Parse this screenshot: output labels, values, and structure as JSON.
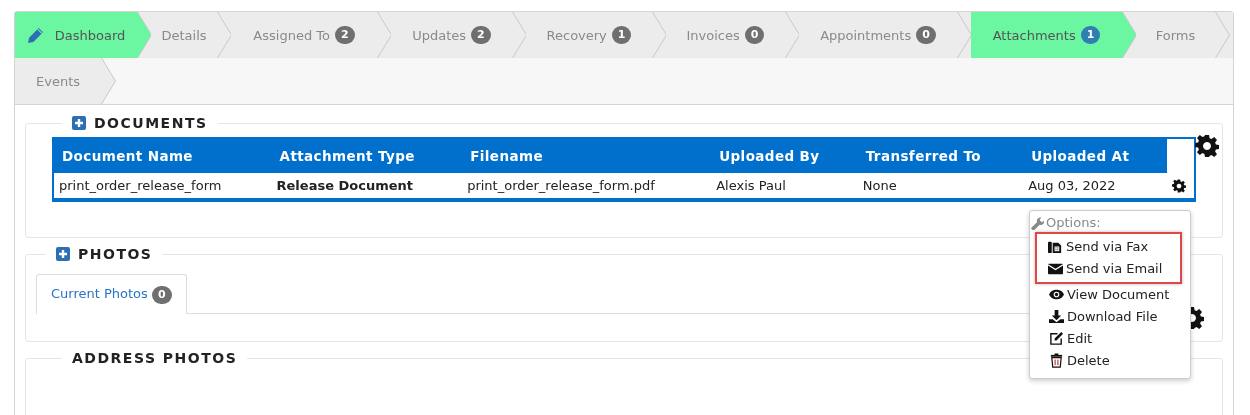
{
  "tabs": [
    {
      "label": "Dashboard",
      "kind": "home",
      "selected": true
    },
    {
      "label": "Details",
      "kind": "plain",
      "selected": false
    },
    {
      "label": "Assigned To",
      "kind": "plain",
      "selected": false,
      "count": "2"
    },
    {
      "label": "Updates",
      "kind": "plain",
      "selected": false,
      "count": "2"
    },
    {
      "label": "Recovery",
      "kind": "plain",
      "selected": false,
      "count": "1"
    },
    {
      "label": "Invoices",
      "kind": "plain",
      "selected": false,
      "count": "0"
    },
    {
      "label": "Appointments",
      "kind": "plain",
      "selected": false,
      "count": "0"
    },
    {
      "label": "Attachments",
      "kind": "plain",
      "selected": true,
      "count": "1"
    },
    {
      "label": "Forms",
      "kind": "plain",
      "selected": false
    },
    {
      "label": "Events",
      "kind": "plain",
      "selected": false
    }
  ],
  "documents": {
    "title": "DOCUMENTS",
    "columns": [
      "Document Name",
      "Attachment Type",
      "Filename",
      "Uploaded By",
      "Transferred To",
      "Uploaded At"
    ],
    "rows": [
      {
        "cells": [
          "print_order_release_form",
          "Release Document",
          "print_order_release_form.pdf",
          "Alexis Paul",
          "None",
          "Aug 03, 2022"
        ]
      }
    ]
  },
  "options_menu": {
    "header": "Options:",
    "items": [
      {
        "label": "Send via Fax",
        "highlighted": true
      },
      {
        "label": "Send via Email",
        "highlighted": true
      },
      {
        "label": "View Document",
        "highlighted": false
      },
      {
        "label": "Download File",
        "highlighted": false
      },
      {
        "label": "Edit",
        "highlighted": false
      },
      {
        "label": "Delete",
        "highlighted": false
      }
    ]
  },
  "photos": {
    "title": "PHOTOS",
    "tabs": [
      {
        "label": "Current Photos",
        "count": "0",
        "selected": true
      }
    ]
  },
  "address_photos": {
    "title": "ADDRESS PHOTOS"
  }
}
